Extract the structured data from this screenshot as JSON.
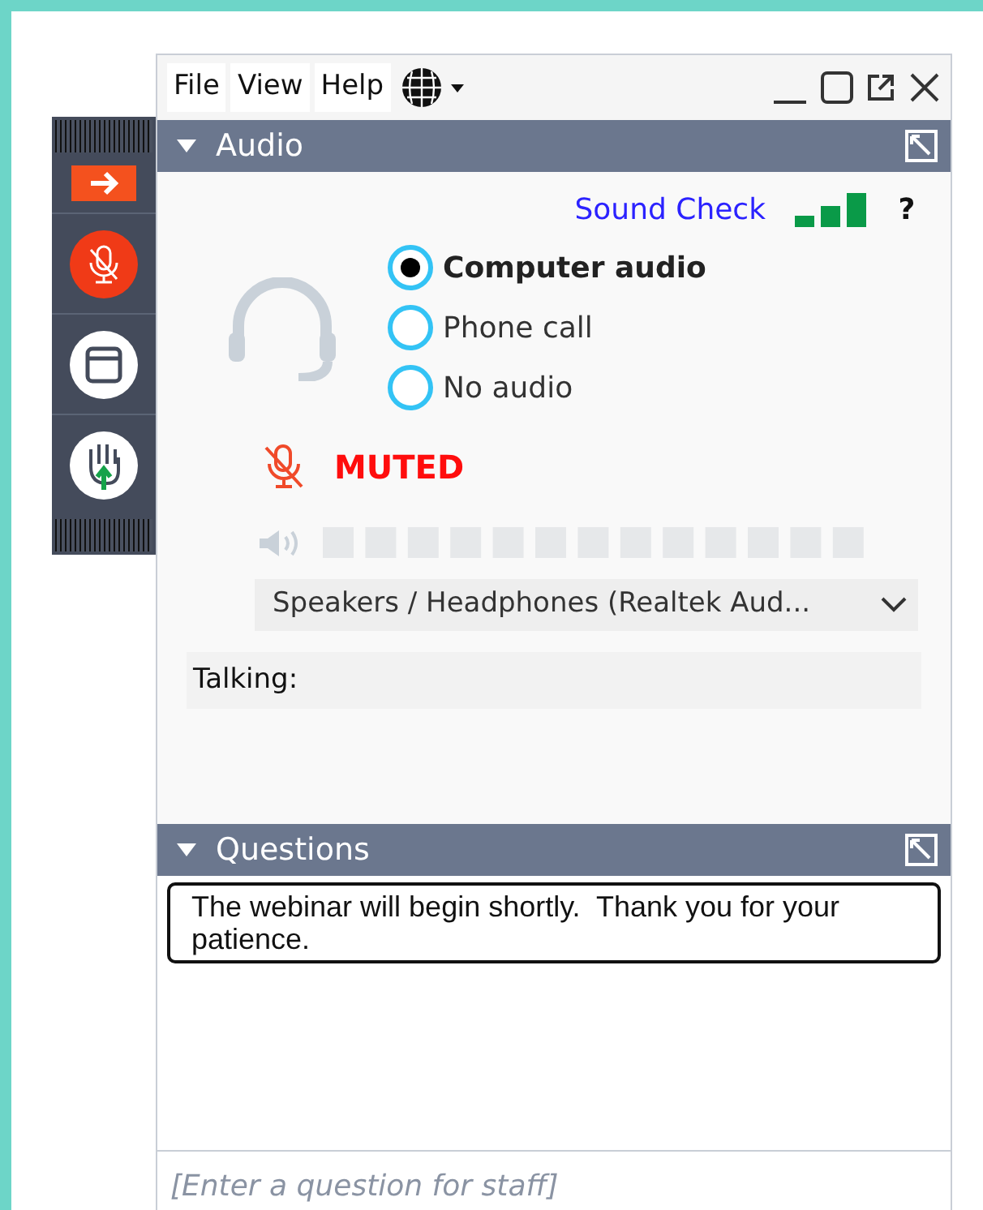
{
  "menu": [
    "File",
    "View",
    "Help"
  ],
  "audio": {
    "title": "Audio",
    "sound_check": "Sound Check",
    "help": "?",
    "options": [
      {
        "label": "Computer audio",
        "selected": true
      },
      {
        "label": "Phone call",
        "selected": false
      },
      {
        "label": "No audio",
        "selected": false
      }
    ],
    "muted": true,
    "status": "MUTED",
    "device": "Speakers / Headphones (Realtek Aud...",
    "talking": "Talking:"
  },
  "questions": {
    "title": "Questions",
    "message": "The webinar will begin shortly.  Thank you for your patience.",
    "placeholder": "[Enter a question for staff]"
  }
}
